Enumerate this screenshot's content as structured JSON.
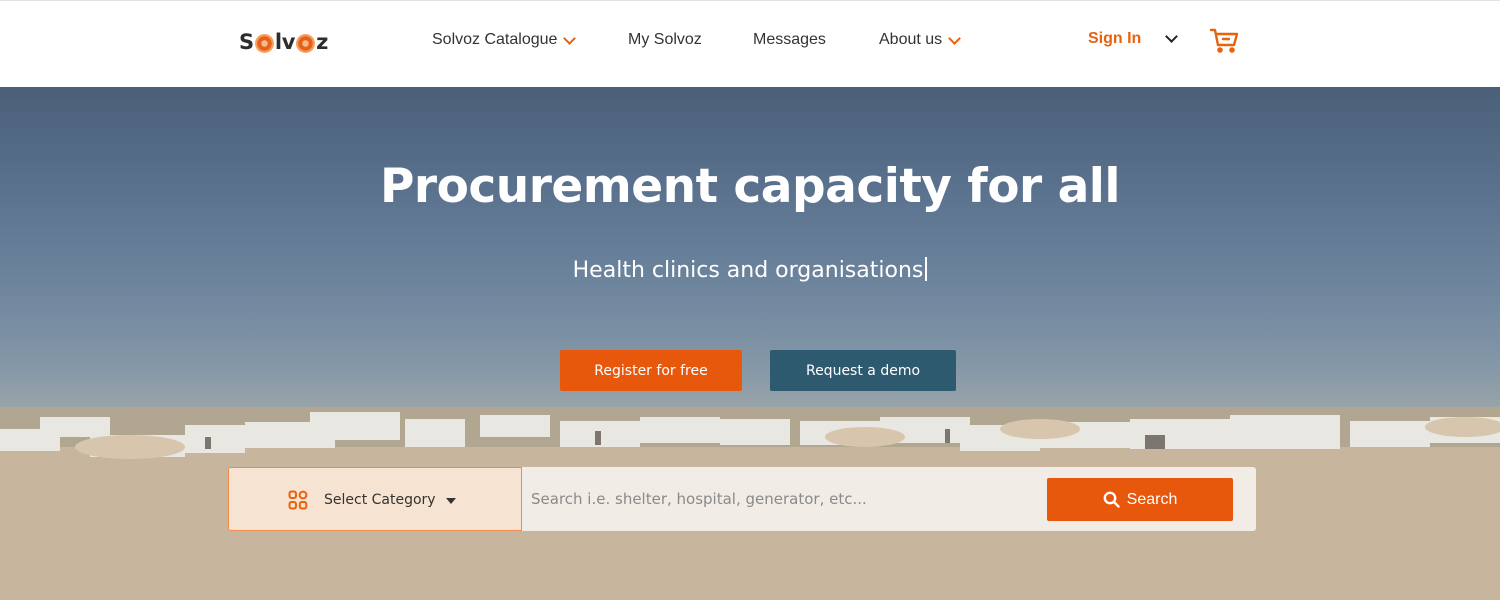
{
  "brand": {
    "logo_text_left": "S",
    "logo_text_l": "lv",
    "logo_text_right": "z",
    "accent": "#e8580c",
    "secondary": "#2e5a70"
  },
  "nav": {
    "items": [
      {
        "label": "Solvoz Catalogue",
        "has_dropdown": true
      },
      {
        "label": "My Solvoz",
        "has_dropdown": false
      },
      {
        "label": "Messages",
        "has_dropdown": false
      },
      {
        "label": "About us",
        "has_dropdown": true
      }
    ],
    "signin_label": "Sign In",
    "language_icon": "chevron-down-icon",
    "cart_icon": "cart-icon"
  },
  "hero": {
    "title": "Procurement capacity for all",
    "subtitle": "Health clinics and organisations",
    "register_label": "Register for free",
    "demo_label": "Request a demo"
  },
  "search": {
    "category_label": "Select Category",
    "category_icon": "grid-icon",
    "placeholder": "Search i.e. shelter, hospital, generator, etc...",
    "value": "",
    "button_label": "Search",
    "button_icon": "search-icon"
  }
}
